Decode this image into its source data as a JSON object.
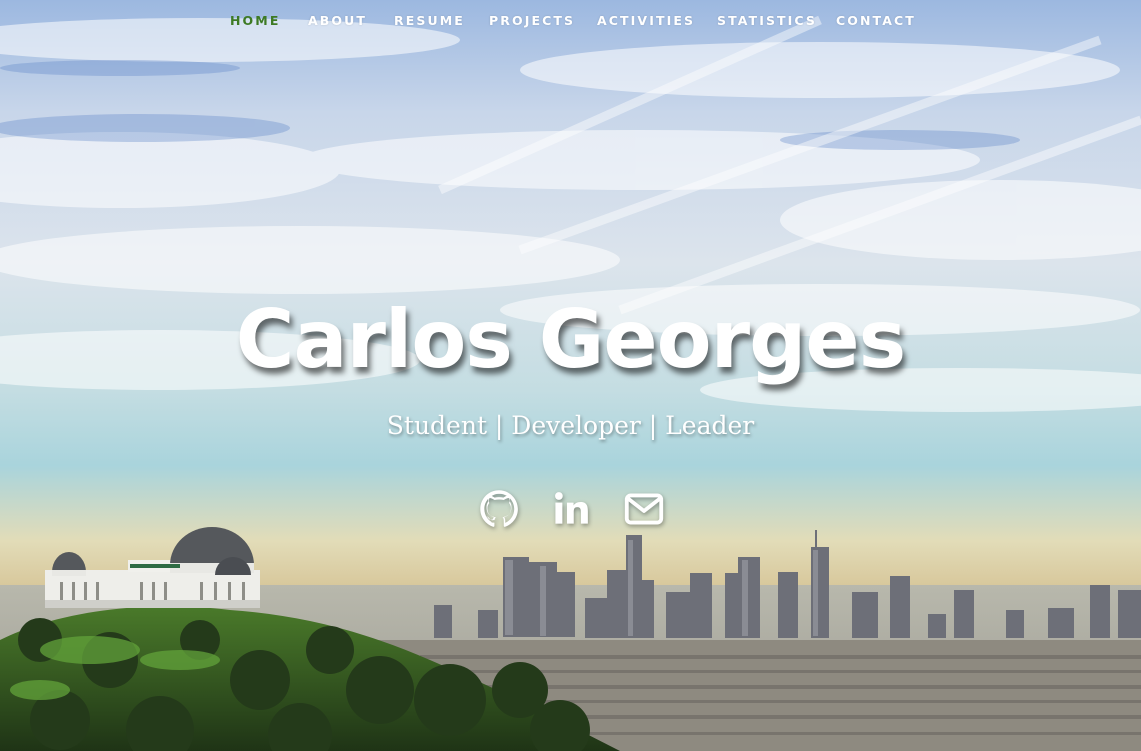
{
  "nav": {
    "items": [
      {
        "label": "HOME",
        "active": true
      },
      {
        "label": "ABOUT",
        "active": false
      },
      {
        "label": "RESUME",
        "active": false
      },
      {
        "label": "PROJECTS",
        "active": false
      },
      {
        "label": "ACTIVITIES",
        "active": false
      },
      {
        "label": "STATISTICS",
        "active": false
      },
      {
        "label": "CONTACT",
        "active": false
      }
    ],
    "active_color": "#3d7a24",
    "color": "#ffffff"
  },
  "hero": {
    "title": "Carlos Georges",
    "subtitle": "Student | Developer | Leader",
    "background": "los-angeles-skyline-with-griffith-observatory"
  },
  "social": [
    {
      "icon": "github-icon",
      "name": "GitHub"
    },
    {
      "icon": "linkedin-icon",
      "name": "LinkedIn"
    },
    {
      "icon": "envelope-icon",
      "name": "Email"
    }
  ]
}
